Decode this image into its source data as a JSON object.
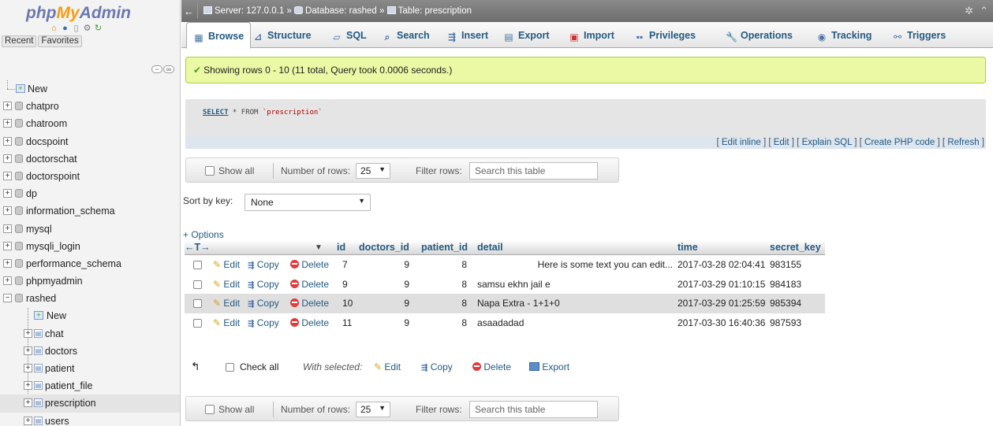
{
  "nav": {
    "logo": {
      "php": "php",
      "my": "My",
      "admin": "Admin"
    },
    "icons": [
      "home-icon",
      "exit-icon",
      "docs-icon",
      "settings-icon",
      "reload-icon"
    ],
    "tabs": [
      "Recent",
      "Favorites"
    ],
    "tree": {
      "new_label": "New",
      "databases": [
        "chatpro",
        "chatroom",
        "docspoint",
        "doctorschat",
        "doctorspoint",
        "dp",
        "information_schema",
        "mysql",
        "mysqli_login",
        "performance_schema",
        "phpmyadmin",
        "rashed"
      ],
      "rashed_children": {
        "new_label": "New",
        "tables": [
          "chat",
          "doctors",
          "patient",
          "patient_file",
          "prescription",
          "users"
        ]
      }
    }
  },
  "topbar": {
    "server_label": "Server: 127.0.0.1",
    "db_label": "Database: rashed",
    "table_label": "Table: prescription",
    "sep": "»"
  },
  "tabs": [
    "Browse",
    "Structure",
    "SQL",
    "Search",
    "Insert",
    "Export",
    "Import",
    "Privileges",
    "Operations",
    "Tracking",
    "Triggers"
  ],
  "message": "Showing rows 0 - 10 (11 total, Query took 0.0006 seconds.)",
  "sql": {
    "kw": "SELECT",
    "rest": " * FROM ",
    "table": "`prescription`"
  },
  "sql_links": [
    "Edit inline",
    "Edit",
    "Explain SQL",
    "Create PHP code",
    "Refresh"
  ],
  "navbar": {
    "show_all": "Show all",
    "num_rows_label": "Number of rows:",
    "num_rows_value": "25",
    "filter_label": "Filter rows:",
    "filter_placeholder": "Search this table"
  },
  "sort": {
    "label": "Sort by key:",
    "value": "None"
  },
  "options_label": "+ Options",
  "table": {
    "arrows": "←T→",
    "columns": [
      "id",
      "doctors_id",
      "patient_id",
      "detail",
      "time",
      "secret_key"
    ],
    "actions": {
      "edit": "Edit",
      "copy": "Copy",
      "delete": "Delete"
    },
    "rows": [
      {
        "id": "7",
        "doctors_id": "9",
        "patient_id": "8",
        "detail": "Here is some text you can edit...",
        "time": "2017-03-28 02:04:41",
        "secret_key": "983155"
      },
      {
        "id": "9",
        "doctors_id": "9",
        "patient_id": "8",
        "detail": "samsu ekhn jail e",
        "time": "2017-03-29 01:10:15",
        "secret_key": "984183"
      },
      {
        "id": "10",
        "doctors_id": "9",
        "patient_id": "8",
        "detail": "Napa Extra - 1+1+0",
        "time": "2017-03-29 01:25:59",
        "secret_key": "985394"
      },
      {
        "id": "11",
        "doctors_id": "9",
        "patient_id": "8",
        "detail": "asaadadad",
        "time": "2017-03-30 16:40:36",
        "secret_key": "987593"
      }
    ]
  },
  "bulk": {
    "check_all": "Check all",
    "with_selected": "With selected:",
    "edit": "Edit",
    "copy": "Copy",
    "delete": "Delete",
    "export": "Export"
  },
  "colors": {
    "accent": "#235a81",
    "success_bg": "#ebf8a4",
    "logo_orange": "#f89c0e",
    "logo_blue": "#6c78af"
  }
}
